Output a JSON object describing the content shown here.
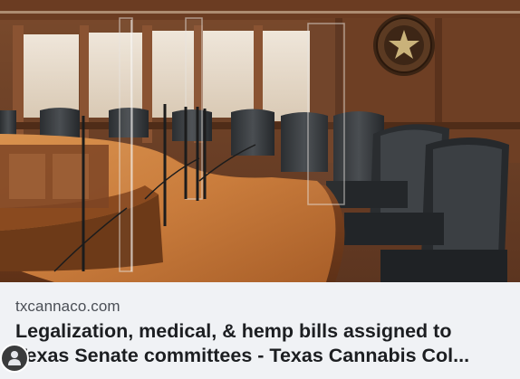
{
  "link_preview": {
    "domain": "txcannaco.com",
    "title_line1": "Legalization, medical, & hemp bills assigned to",
    "title_line2": "Texas Senate committees - Texas Cannabis Col...",
    "image_icon": "senate-chamber-photo"
  },
  "avatar": {
    "icon": "person-icon"
  },
  "colors": {
    "card_bg": "#f0f2f5",
    "domain_text": "#4b4f56",
    "title_text": "#1c1e21",
    "wood": "#b86a33"
  }
}
